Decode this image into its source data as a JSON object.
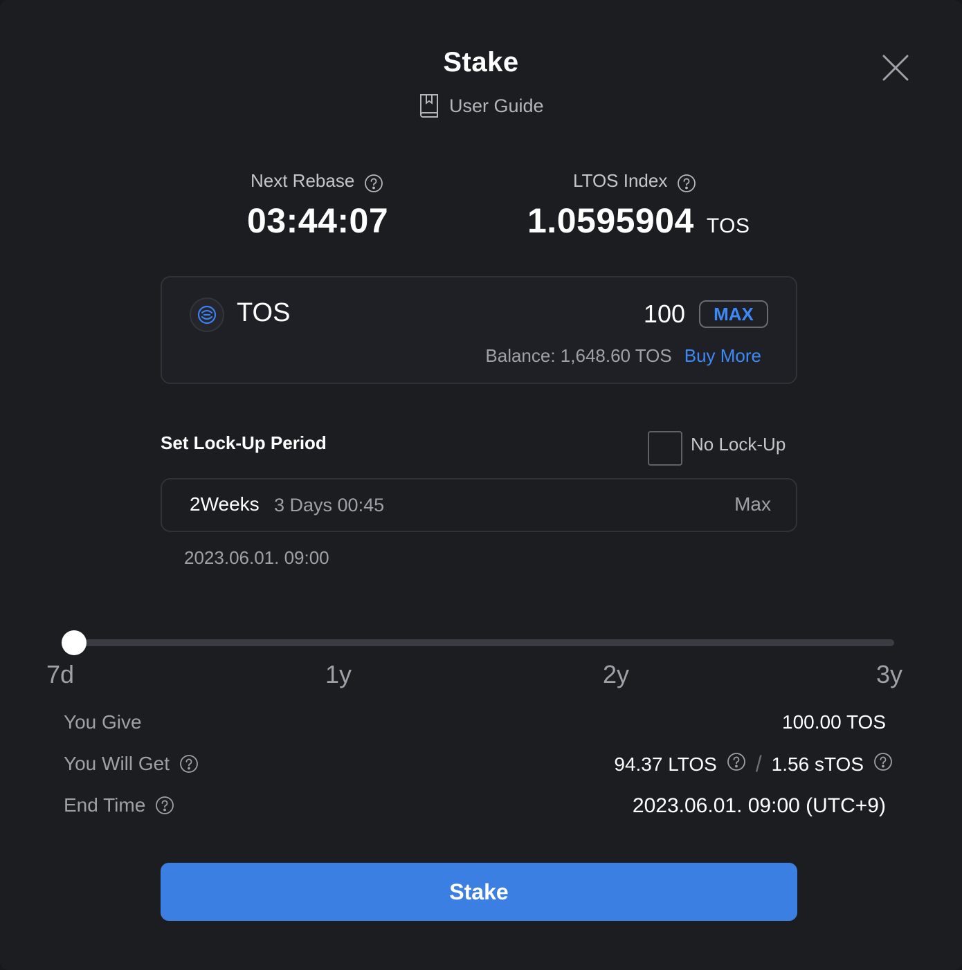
{
  "modal": {
    "title": "Stake",
    "user_guide_label": "User Guide"
  },
  "stats": {
    "next_rebase": {
      "label": "Next Rebase",
      "value": "03:44:07"
    },
    "ltos_index": {
      "label": "LTOS Index",
      "value": "1.0595904",
      "unit": "TOS"
    }
  },
  "token_input": {
    "token_name": "TOS",
    "amount": "100",
    "max_label": "MAX",
    "balance_text": "Balance: 1,648.60 TOS",
    "buy_more_label": "Buy More"
  },
  "lockup": {
    "title": "Set Lock-Up Period",
    "no_lockup_label": "No Lock-Up",
    "no_lockup_checked": false,
    "weeks": "2Weeks",
    "days_time": "3 Days 00:45",
    "max_label": "Max",
    "date": "2023.06.01. 09:00"
  },
  "slider": {
    "ticks": [
      "7d",
      "1y",
      "2y",
      "3y"
    ],
    "position_fraction": 0
  },
  "summary": {
    "you_give": {
      "label": "You Give",
      "value": "100.00 TOS"
    },
    "you_will_get": {
      "label": "You Will Get",
      "ltos": "94.37 LTOS",
      "separator": "/",
      "stos": "1.56 sTOS"
    },
    "end_time": {
      "label": "End Time",
      "value": "2023.06.01. 09:00 (UTC+9)"
    }
  },
  "actions": {
    "stake_label": "Stake"
  },
  "colors": {
    "background": "#1c1d21",
    "accent": "#3d8af7",
    "button": "#3c7fe2"
  }
}
